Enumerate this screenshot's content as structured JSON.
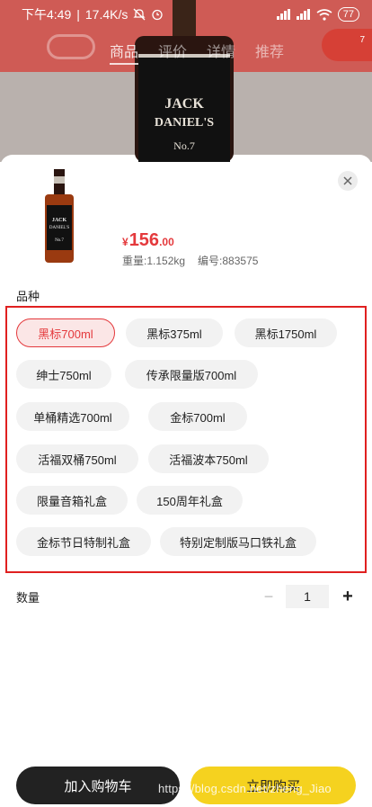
{
  "status_bar": {
    "time": "下午4:49",
    "speed": "17.4K/s",
    "battery": "77"
  },
  "background_tabs": [
    "商品",
    "评价",
    "详情",
    "推荐"
  ],
  "background_badge_count": "7",
  "product": {
    "currency": "¥",
    "price_int": "156",
    "price_dec": ".00",
    "weight": "重量:1.152kg",
    "code": "编号:883575"
  },
  "variant_section_label": "品种",
  "variants": [
    "黑标700ml",
    "黑标375ml",
    "黑标1750ml",
    "绅士750ml",
    "传承限量版700ml",
    "单桶精选700ml",
    "金标700ml",
    "活福双桶750ml",
    "活福波本750ml",
    "限量音箱礼盒",
    "150周年礼盒",
    "金标节日特制礼盒",
    "特别定制版马口铁礼盒"
  ],
  "selected_variant": "黑标700ml",
  "quantity": {
    "label": "数量",
    "value": "1",
    "minus": "−",
    "plus": "+"
  },
  "actions": {
    "add_to_cart": "加入购物车",
    "buy_now": "立即购买"
  },
  "watermark": "https://blog.csdn.net/zheng_Jiao",
  "colors": {
    "accent_red": "#e4393c",
    "buy_yellow": "#f5d21f",
    "cart_black": "#222222"
  }
}
